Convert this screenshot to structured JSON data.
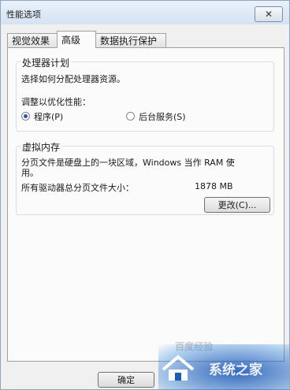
{
  "window": {
    "title": "性能选项",
    "close_symbol": "✕"
  },
  "tabs": [
    {
      "label": "视觉效果",
      "active": false
    },
    {
      "label": "高级",
      "active": true
    },
    {
      "label": "数据执行保护",
      "active": false
    }
  ],
  "processor": {
    "title": "处理器计划",
    "desc": "选择如何分配处理器资源。",
    "adjust_label": "调整以优化性能：",
    "options": [
      {
        "label": "程序(P)",
        "selected": true
      },
      {
        "label": "后台服务(S)",
        "selected": false
      }
    ]
  },
  "vm": {
    "title": "虚拟内存",
    "desc_line1": "分页文件是硬盘上的一块区域，Windows 当作 RAM 使",
    "desc_line2": "用。",
    "total_label": "所有驱动器总分页文件大小：",
    "total_value": "1878 MB",
    "change_button": "更改(C)..."
  },
  "footer": {
    "ok_button": "确定"
  },
  "watermark": {
    "brand": "系统之家",
    "partial": "百度经验"
  }
}
